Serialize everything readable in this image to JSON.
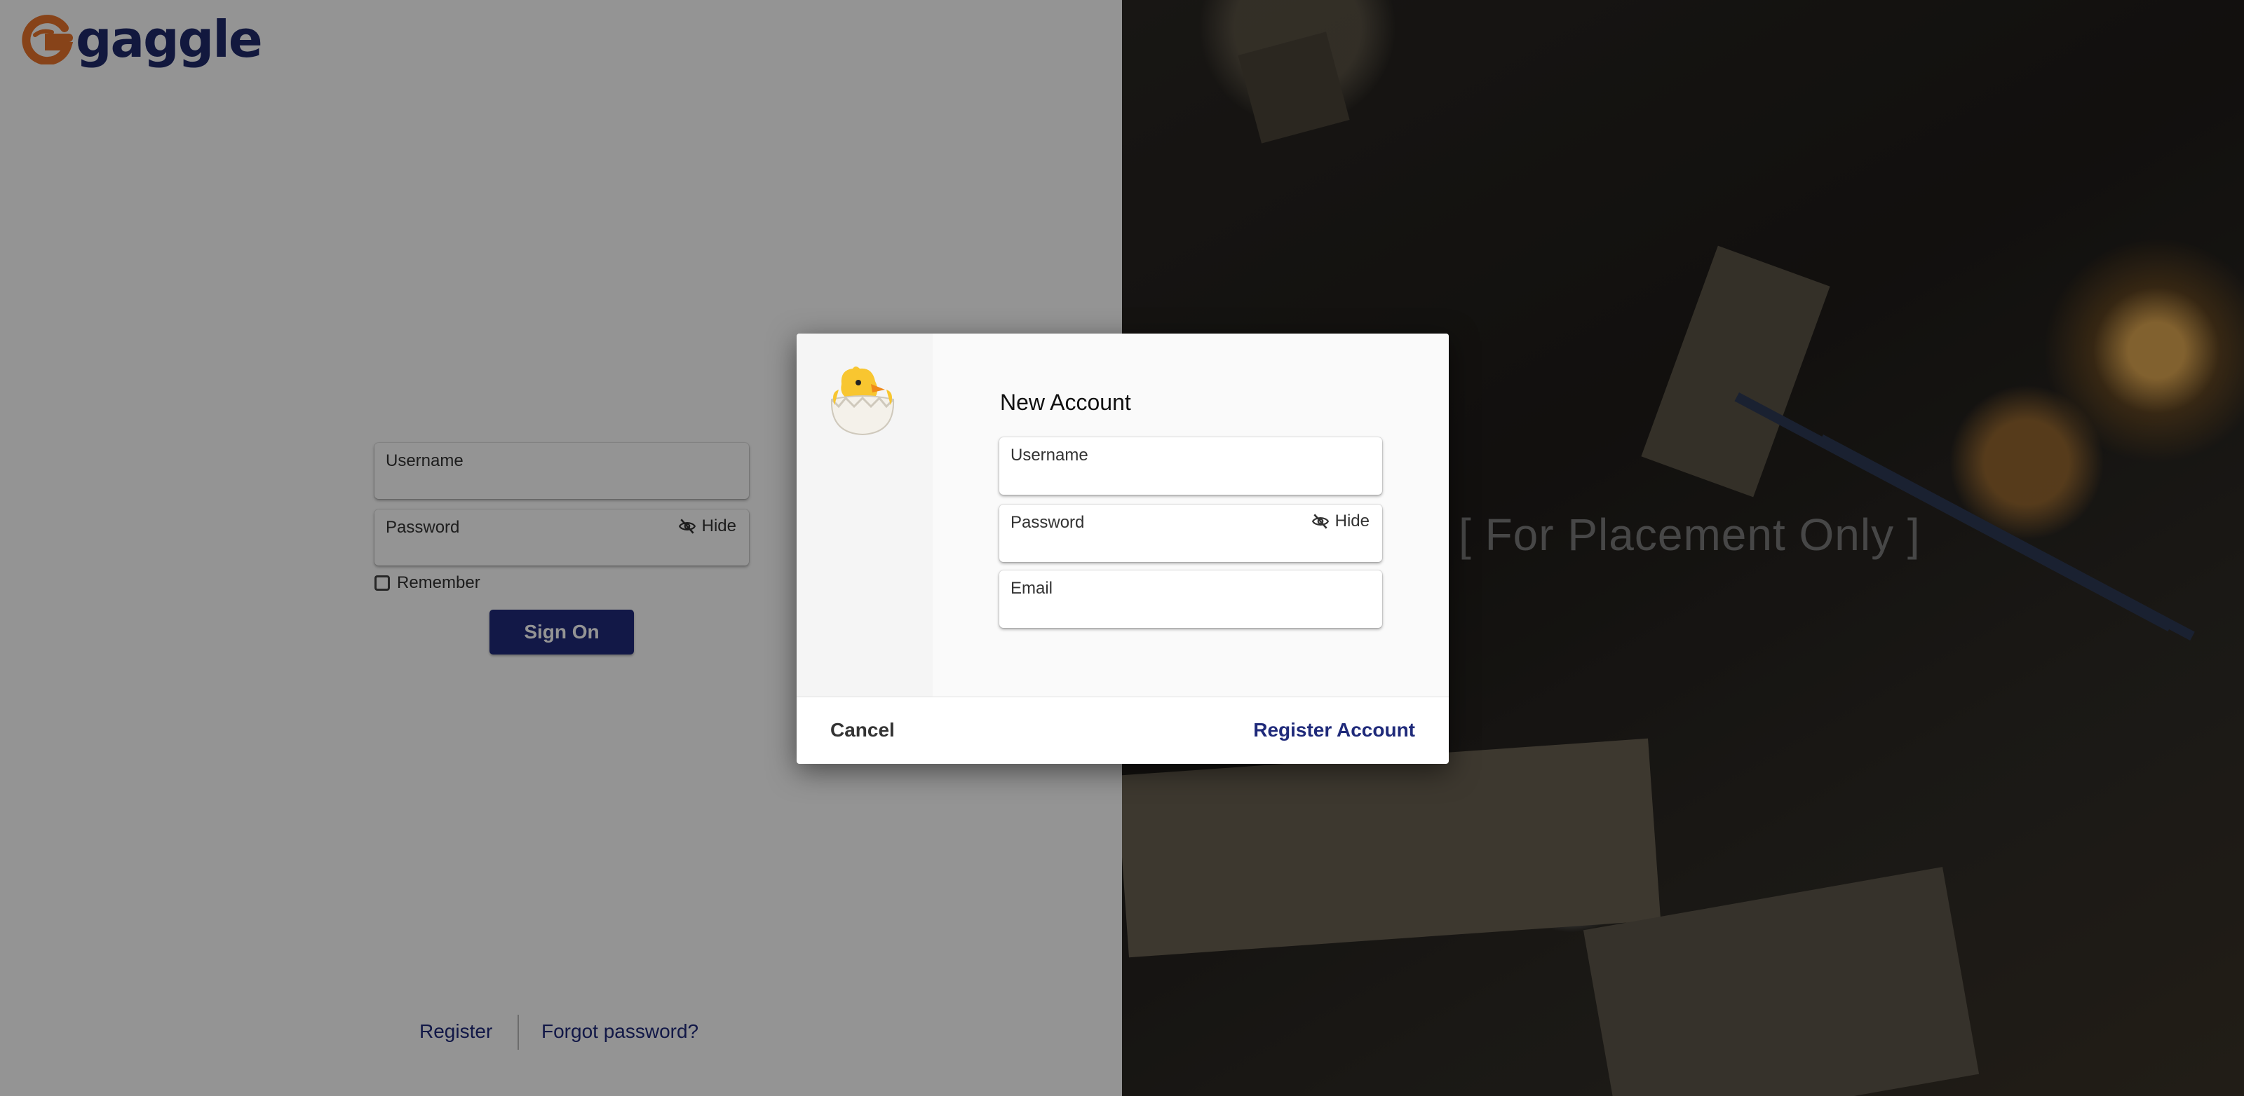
{
  "brand": {
    "name": "gaggle",
    "logo_icon": "gaggle-g-icon",
    "primary_color": "#1f2a7a",
    "accent_color": "#e8742c"
  },
  "login": {
    "username_label": "Username",
    "password_label": "Password",
    "hide_label": "Hide",
    "remember_label": "Remember",
    "signon_label": "Sign On"
  },
  "footer": {
    "register_label": "Register",
    "forgot_label": "Forgot password?"
  },
  "hero": {
    "placeholder_text": "[ For Placement Only ]"
  },
  "dialog": {
    "title": "New Account",
    "icon": "hatching-chick-icon",
    "username_label": "Username",
    "password_label": "Password",
    "hide_label": "Hide",
    "email_label": "Email",
    "cancel_label": "Cancel",
    "register_label": "Register Account"
  }
}
